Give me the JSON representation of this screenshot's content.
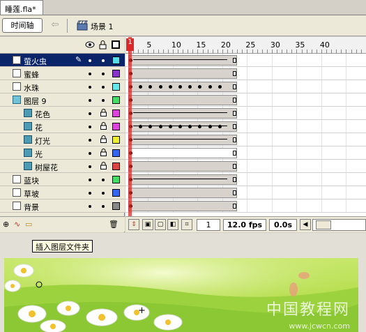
{
  "document": {
    "tab_title": "睡莲.fla*"
  },
  "toolbar": {
    "timeline_button": "时间轴",
    "back_arrow": "⇦",
    "scene_label": "场景 1"
  },
  "layer_header": {
    "eye_icon": "eye-icon",
    "lock_icon": "lock-icon",
    "outline_icon": "outline-icon"
  },
  "layers": [
    {
      "name": "萤火虫",
      "color": "#55dde8",
      "selected": true,
      "indent": 0,
      "type": "normal",
      "locked": false
    },
    {
      "name": "蜜蜂",
      "color": "#8833cc",
      "selected": false,
      "indent": 0,
      "type": "normal",
      "locked": false
    },
    {
      "name": "水珠",
      "color": "#66e8e8",
      "selected": false,
      "indent": 0,
      "type": "normal",
      "locked": false
    },
    {
      "name": "图层 9",
      "color": "#44dd66",
      "selected": false,
      "indent": 0,
      "type": "mask",
      "locked": false
    },
    {
      "name": "花色",
      "color": "#dd44dd",
      "selected": false,
      "indent": 1,
      "type": "masked",
      "locked": true
    },
    {
      "name": "花",
      "color": "#dd44dd",
      "selected": false,
      "indent": 1,
      "type": "masked",
      "locked": true
    },
    {
      "name": "灯光",
      "color": "#eeee33",
      "selected": false,
      "indent": 1,
      "type": "masked",
      "locked": true
    },
    {
      "name": "光",
      "color": "#3366ee",
      "selected": false,
      "indent": 1,
      "type": "masked",
      "locked": true
    },
    {
      "name": "树屋花",
      "color": "#dd4444",
      "selected": false,
      "indent": 1,
      "type": "masked",
      "locked": true
    },
    {
      "name": "蓝块",
      "color": "#44dd66",
      "selected": false,
      "indent": 0,
      "type": "normal",
      "locked": false
    },
    {
      "name": "草坡",
      "color": "#3366ee",
      "selected": false,
      "indent": 0,
      "type": "normal",
      "locked": false
    },
    {
      "name": "背景",
      "color": "#888888",
      "selected": false,
      "indent": 0,
      "type": "normal",
      "locked": false
    }
  ],
  "ruler": {
    "marks": [
      "1",
      "5",
      "10",
      "15",
      "20",
      "25",
      "30",
      "35",
      "40"
    ]
  },
  "status": {
    "current_frame": "1",
    "frame_rate": "12.0 fps",
    "elapsed": "0.0s"
  },
  "tooltip": "插入图层文件夹",
  "watermark": {
    "main": "中国教程网",
    "sub": "www.jcwcn.com"
  }
}
